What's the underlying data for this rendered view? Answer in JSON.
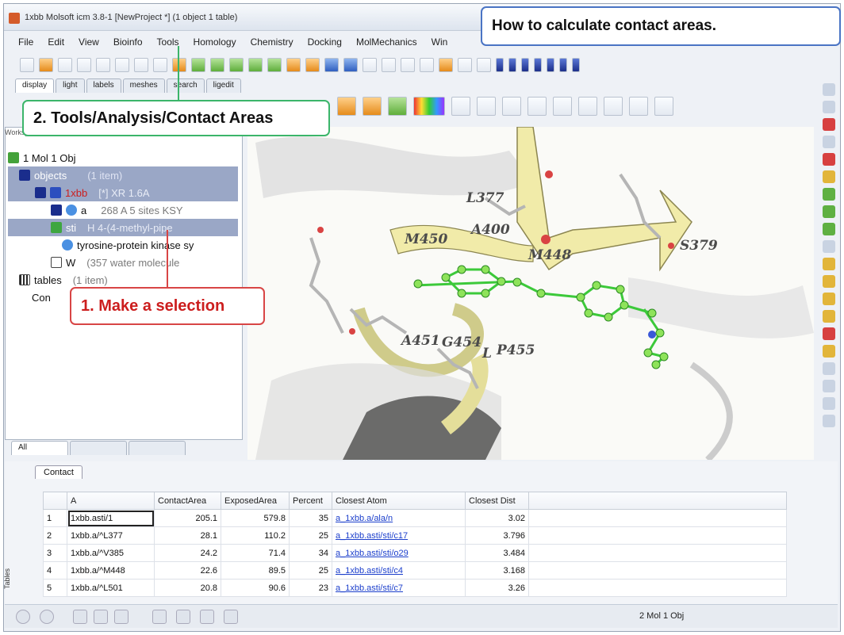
{
  "window": {
    "title": "1xbb Molsoft icm 3.8-1  [NewProject *] (1 object 1 table)"
  },
  "menu": [
    "File",
    "Edit",
    "View",
    "Bioinfo",
    "Tools",
    "Homology",
    "Chemistry",
    "Docking",
    "MolMechanics",
    "Win"
  ],
  "tabs": [
    "display",
    "light",
    "labels",
    "meshes",
    "search",
    "ligedit"
  ],
  "workspace": {
    "header": "Workspace Panel",
    "tree": {
      "root": "1 Mol 1 Obj",
      "objects": {
        "label": "objects",
        "count": "(1 item)"
      },
      "obj1": {
        "name": "1xbb",
        "info": "[*] XR  1.6A"
      },
      "chain_a": {
        "name": "a",
        "info": "268 A  5 sites KSY"
      },
      "chain_sti": {
        "name": "sti",
        "info": "H  4-(4-methyl-pipe"
      },
      "kinase": {
        "name": "tyrosine-protein kinase sy"
      },
      "water": {
        "name": "W",
        "info": "(357 water molecule"
      },
      "tables": {
        "label": "tables",
        "count": "(1 item)"
      },
      "contact": {
        "name": "Con"
      }
    },
    "bottom_tabs": [
      "All",
      "",
      ""
    ]
  },
  "viewer": {
    "residues": [
      "L377",
      "M450",
      "A400",
      "M448",
      "S379",
      "A451",
      "G454",
      "P455",
      "L"
    ]
  },
  "callouts": {
    "title": "How to calculate contact areas.",
    "step2": "2. Tools/Analysis/Contact Areas",
    "step1": "1. Make a selection"
  },
  "contact": {
    "tab": "Contact",
    "side_label": "Tables",
    "columns": [
      "",
      "A",
      "ContactArea",
      "ExposedArea",
      "Percent",
      "Closest Atom",
      "Closest Dist"
    ],
    "rows": [
      [
        "1",
        "1xbb.asti/1",
        "205.1",
        "579.8",
        "35",
        "a_1xbb.a/ala/n",
        "3.02"
      ],
      [
        "2",
        "1xbb.a/^L377",
        "28.1",
        "110.2",
        "25",
        "a_1xbb.asti/sti/c17",
        "3.796"
      ],
      [
        "3",
        "1xbb.a/^V385",
        "24.2",
        "71.4",
        "34",
        "a_1xbb.asti/sti/o29",
        "3.484"
      ],
      [
        "4",
        "1xbb.a/^M448",
        "22.6",
        "89.5",
        "25",
        "a_1xbb.asti/sti/c4",
        "3.168"
      ],
      [
        "5",
        "1xbb.a/^L501",
        "20.8",
        "90.6",
        "23",
        "a_1xbb.asti/sti/c7",
        "3.26"
      ]
    ]
  },
  "status": {
    "text": "2 Mol 1 Obj"
  }
}
